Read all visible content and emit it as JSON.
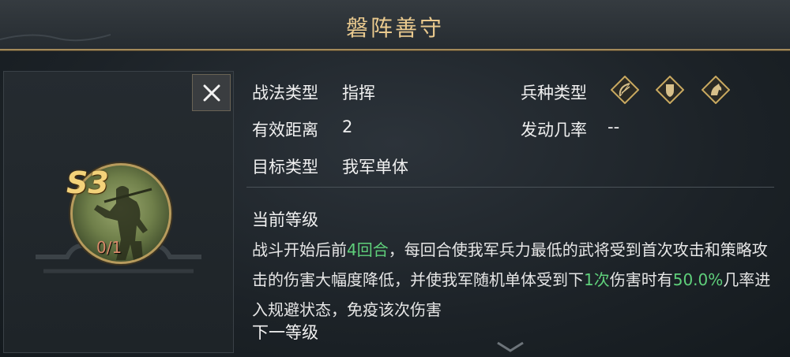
{
  "title": "磐阵善守",
  "skill": {
    "grade": "S3",
    "level": "0/1"
  },
  "info": {
    "tactic_type_label": "战法类型",
    "tactic_type_value": "指挥",
    "range_label": "有效距离",
    "range_value": "2",
    "target_label": "目标类型",
    "target_value": "我军单体",
    "troop_type_label": "兵种类型",
    "troop_icons": [
      "bow-icon",
      "shield-icon",
      "horse-icon"
    ],
    "trigger_label": "发动几率",
    "trigger_value": "--"
  },
  "current_level": {
    "label": "当前等级",
    "desc_parts": [
      {
        "text": "战斗开始后前",
        "hl": false
      },
      {
        "text": "4回合",
        "hl": true
      },
      {
        "text": "，每回合使我军兵力最低的武将受到首次攻击和策略攻击的伤害大幅度降低，并使我军随机单体受到下",
        "hl": false
      },
      {
        "text": "1次",
        "hl": true
      },
      {
        "text": "伤害时有",
        "hl": false
      },
      {
        "text": "50.0%",
        "hl": true
      },
      {
        "text": "几率进入规避状态，免疫该次伤害",
        "hl": false
      }
    ]
  },
  "next_level": {
    "label": "下一等级"
  },
  "colors": {
    "highlight": "#5fd07b",
    "gold": "#e9c98e",
    "grade": "#f3d27a"
  }
}
